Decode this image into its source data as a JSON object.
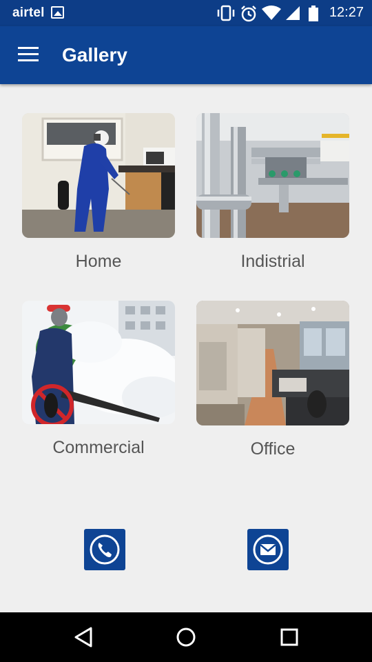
{
  "status_bar": {
    "carrier": "airtel",
    "time": "12:27",
    "icons": [
      "gallery-icon",
      "vibrate-icon",
      "alarm-icon",
      "wifi-icon",
      "signal-icon",
      "battery-icon"
    ]
  },
  "app_bar": {
    "title": "Gallery",
    "menu_icon": "hamburger-menu-icon"
  },
  "gallery": {
    "items": [
      {
        "label": "Home"
      },
      {
        "label": "Indistrial"
      },
      {
        "label": "Commercial"
      },
      {
        "label": "Office"
      }
    ]
  },
  "contact": {
    "call_icon": "phone-icon",
    "mail_icon": "mail-icon"
  },
  "nav_bar": {
    "icons": [
      "back-icon",
      "home-icon",
      "recents-icon"
    ]
  },
  "colors": {
    "primary": "#0e4494",
    "status_bar": "#0d3d87",
    "background": "#efefef",
    "label_text": "#555555"
  }
}
